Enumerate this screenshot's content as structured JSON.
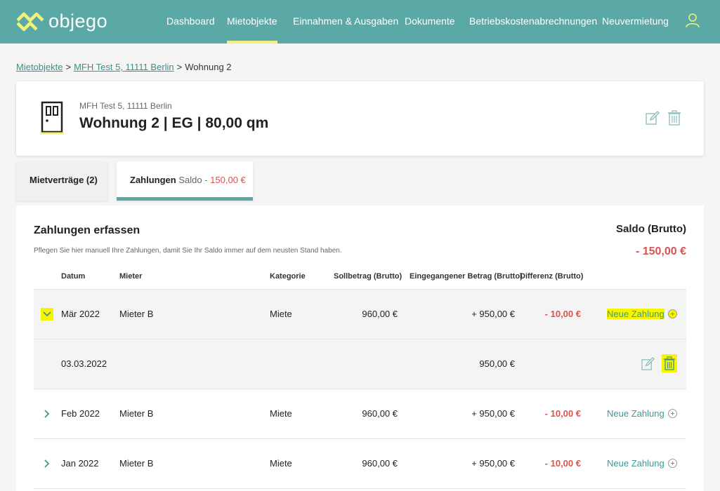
{
  "brand": {
    "name": "objego"
  },
  "nav": {
    "items": [
      {
        "label": "Dashboard"
      },
      {
        "label": "Mietobjekte"
      },
      {
        "label": "Einnahmen & Ausgaben"
      },
      {
        "label": "Dokumente"
      },
      {
        "label": "Betriebskostenabrechnungen"
      },
      {
        "label": "Neuvermietung"
      }
    ],
    "active": "Mietobjekte"
  },
  "breadcrumb": {
    "items": [
      "Mietobjekte",
      "MFH Test 5, 11111 Berlin"
    ],
    "current": "Wohnung 2",
    "separator": ">"
  },
  "header": {
    "subtitle": "MFH Test 5, 11111 Berlin",
    "title": "Wohnung 2 | EG | 80,00 qm"
  },
  "tabs": {
    "mietvertraege": "Mietverträge (2)",
    "zahlungen": "Zahlungen",
    "saldo_label": "Saldo",
    "saldo_value": "- 150,00 €"
  },
  "panel": {
    "title": "Zahlungen erfassen",
    "description": "Pflegen Sie hier manuell Ihre Zahlungen, damit Sie Ihr Saldo immer auf dem neusten Stand haben.",
    "saldo_label": "Saldo (Brutto)",
    "saldo_value": "- 150,00 €"
  },
  "table": {
    "headers": {
      "datum": "Datum",
      "mieter": "Mieter",
      "kategorie": "Kategorie",
      "soll": "Sollbetrag (Brutto)",
      "eingang": "Eingegangener Betrag (Brutto)",
      "differenz": "Differenz (Brutto)"
    },
    "rows": [
      {
        "datum": "Mär 2022",
        "mieter": "Mieter B",
        "kategorie": "Miete",
        "soll": "960,00 €",
        "eingang": "+ 950,00 €",
        "differenz": "- 10,00 €",
        "action": "Neue Zahlung"
      },
      {
        "datum": "03.03.2022",
        "eingang": "950,00 €"
      },
      {
        "datum": "Feb 2022",
        "mieter": "Mieter B",
        "kategorie": "Miete",
        "soll": "960,00 €",
        "eingang": "+ 950,00 €",
        "differenz": "- 10,00 €",
        "action": "Neue Zahlung"
      },
      {
        "datum": "Jan 2022",
        "mieter": "Mieter B",
        "kategorie": "Miete",
        "soll": "960,00 €",
        "eingang": "+ 950,00 €",
        "differenz": "- 10,00 €",
        "action": "Neue Zahlung"
      }
    ]
  },
  "colors": {
    "primary": "#5aa9a6",
    "highlight": "#f5f500",
    "negative": "#d9534f",
    "link": "#3c8f8c"
  }
}
